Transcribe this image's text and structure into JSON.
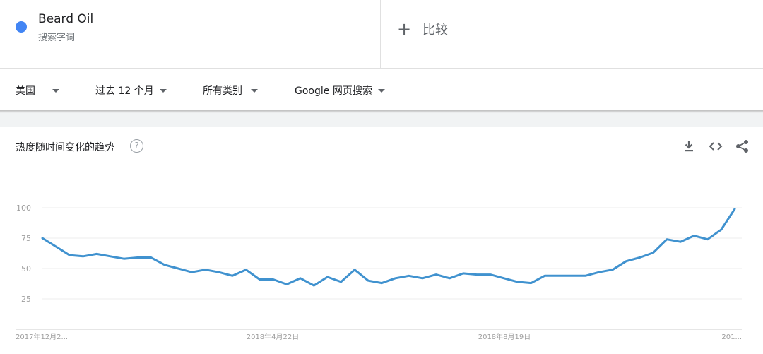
{
  "term": {
    "name": "Beard Oil",
    "type": "搜索字词",
    "color": "#4285f4"
  },
  "compare": {
    "plus": "+",
    "label": "比较"
  },
  "filters": [
    {
      "label": "美国"
    },
    {
      "label": "过去 12 个月"
    },
    {
      "label": "所有类别"
    },
    {
      "label": "Google 网页搜索"
    }
  ],
  "card": {
    "title": "热度随时间变化的趋势",
    "help": "?"
  },
  "chart_data": {
    "type": "line",
    "yticks": [
      25,
      50,
      75,
      100
    ],
    "ylim": [
      0,
      100
    ],
    "xlabels": [
      "2017年12月2...",
      "2018年4月22日",
      "2018年8月19日",
      "201..."
    ],
    "series": [
      {
        "color": "#4092cf",
        "values": [
          75,
          68,
          61,
          60,
          62,
          60,
          58,
          59,
          59,
          53,
          50,
          47,
          49,
          47,
          44,
          49,
          41,
          41,
          37,
          42,
          36,
          43,
          39,
          49,
          40,
          38,
          42,
          44,
          42,
          45,
          42,
          46,
          45,
          45,
          42,
          39,
          38,
          44,
          44,
          44,
          44,
          47,
          49,
          56,
          59,
          63,
          74,
          72,
          77,
          74,
          82,
          99
        ]
      }
    ]
  }
}
